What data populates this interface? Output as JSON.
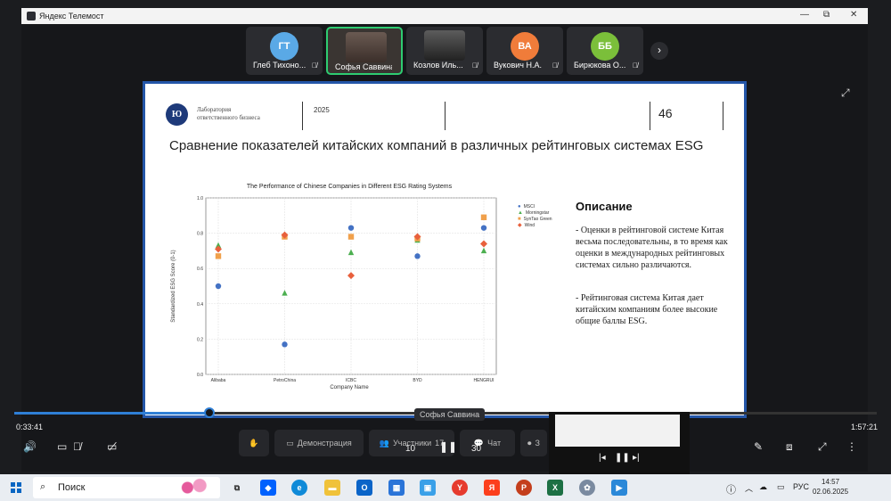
{
  "window": {
    "title": "Яндекс Телемост",
    "min": "—",
    "max": "⧉",
    "close": "✕"
  },
  "participants": [
    {
      "initials": "ГТ",
      "name": "Глеб Тихоно...",
      "color": "#5aa9e6"
    },
    {
      "initials": "",
      "name": "Софья Саввина",
      "color": "#3a3532"
    },
    {
      "initials": "",
      "name": "Козлов Иль...",
      "color": "#3a3a3a"
    },
    {
      "initials": "ВА",
      "name": "Вукович Н.А.",
      "color": "#f07c3a"
    },
    {
      "initials": "ББ",
      "name": "Бирюкова О...",
      "color": "#7bbf3a"
    }
  ],
  "slide": {
    "logo": "Ю",
    "lab_line1": "Лаборатория",
    "lab_line2": "ответственного бизнеса",
    "year": "2025",
    "page": "46",
    "title": "Сравнение показателей китайских компаний в различных рейтинговых системах ESG",
    "desc_title": "Описание",
    "desc_p1": "-  Оценки в рейтинговой системе Китая весьма последовательны, в то время как оценки в международных рейтинговых системах сильно различаются.",
    "desc_p2": "-  Рейтинговая система Китая дает китайским компаниям более высокие общие баллы ESG."
  },
  "chart_data": {
    "type": "scatter",
    "title": "The Performance of Chinese Companies in Different ESG Rating Systems",
    "xlabel": "Company Name",
    "ylabel": "Standardized ESG Score (0-1)",
    "categories": [
      "Alibaba",
      "PetroChina",
      "ICBC",
      "BYD",
      "HENGRUI"
    ],
    "ylim": [
      0,
      1.0
    ],
    "yticks": [
      "0.0",
      "0.2",
      "0.4",
      "0.6",
      "0.8",
      "1.0"
    ],
    "grid": true,
    "legend": "right",
    "series": [
      {
        "name": "MSCI",
        "marker": "circle",
        "color": "#4472c4",
        "values": [
          0.5,
          0.17,
          0.83,
          0.67,
          0.83
        ]
      },
      {
        "name": "Morningstar",
        "marker": "triangle",
        "color": "#4caf50",
        "values": [
          0.73,
          0.46,
          0.69,
          0.76,
          0.7
        ]
      },
      {
        "name": "SynTao Green",
        "marker": "square",
        "color": "#f0a04b",
        "values": [
          0.67,
          0.78,
          0.78,
          0.77,
          0.89
        ]
      },
      {
        "name": "Wind",
        "marker": "diamond",
        "color": "#e8603c",
        "values": [
          0.71,
          0.79,
          0.56,
          0.78,
          0.74
        ]
      }
    ]
  },
  "player": {
    "elapsed": "0:33:41",
    "total": "1:57:21",
    "progress": 0.226,
    "speaker_label": "Софья Саввина",
    "rewind": "10",
    "forward": "30"
  },
  "controls": {
    "demo": "Демонстрация",
    "participants": "Участники",
    "participants_count": "17",
    "chat": "Чат",
    "rec": "З"
  },
  "taskbar": {
    "search_placeholder": "Поиск",
    "lang": "РУС",
    "time": "14:57",
    "date": "02.06.2025"
  }
}
